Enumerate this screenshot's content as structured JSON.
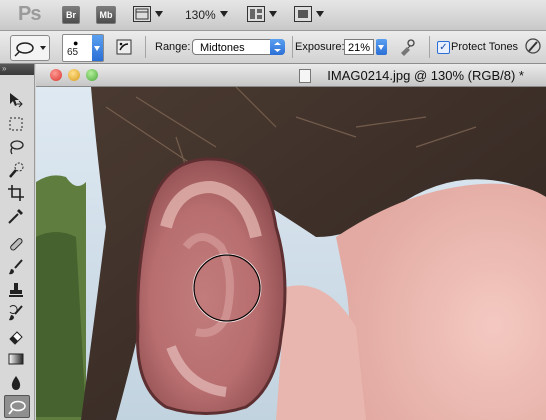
{
  "app": {
    "logo": "Ps",
    "bridge_label": "Br",
    "minibridge_label": "Mb",
    "zoom": "130%"
  },
  "options": {
    "brush_size": "65",
    "range_label": "Range:",
    "range_value": "Midtones",
    "exposure_label": "Exposure:",
    "exposure_value": "21%",
    "protect_tones_label": "Protect Tones",
    "protect_tones_checked": true
  },
  "document": {
    "title": "IMAG0214.jpg @ 130% (RGB/8) *"
  },
  "tools": [
    "move-tool",
    "marquee-tool",
    "lasso-tool",
    "quick-selection-tool",
    "crop-tool",
    "eyedropper-tool",
    "healing-brush-tool",
    "brush-tool",
    "clone-stamp-tool",
    "history-brush-tool",
    "eraser-tool",
    "gradient-tool",
    "blur-tool",
    "dodge-tool"
  ],
  "colors": {
    "accent": "#2b6fd6",
    "close": "#e0443e",
    "minimize": "#dea123",
    "zoom": "#5bb84a"
  }
}
